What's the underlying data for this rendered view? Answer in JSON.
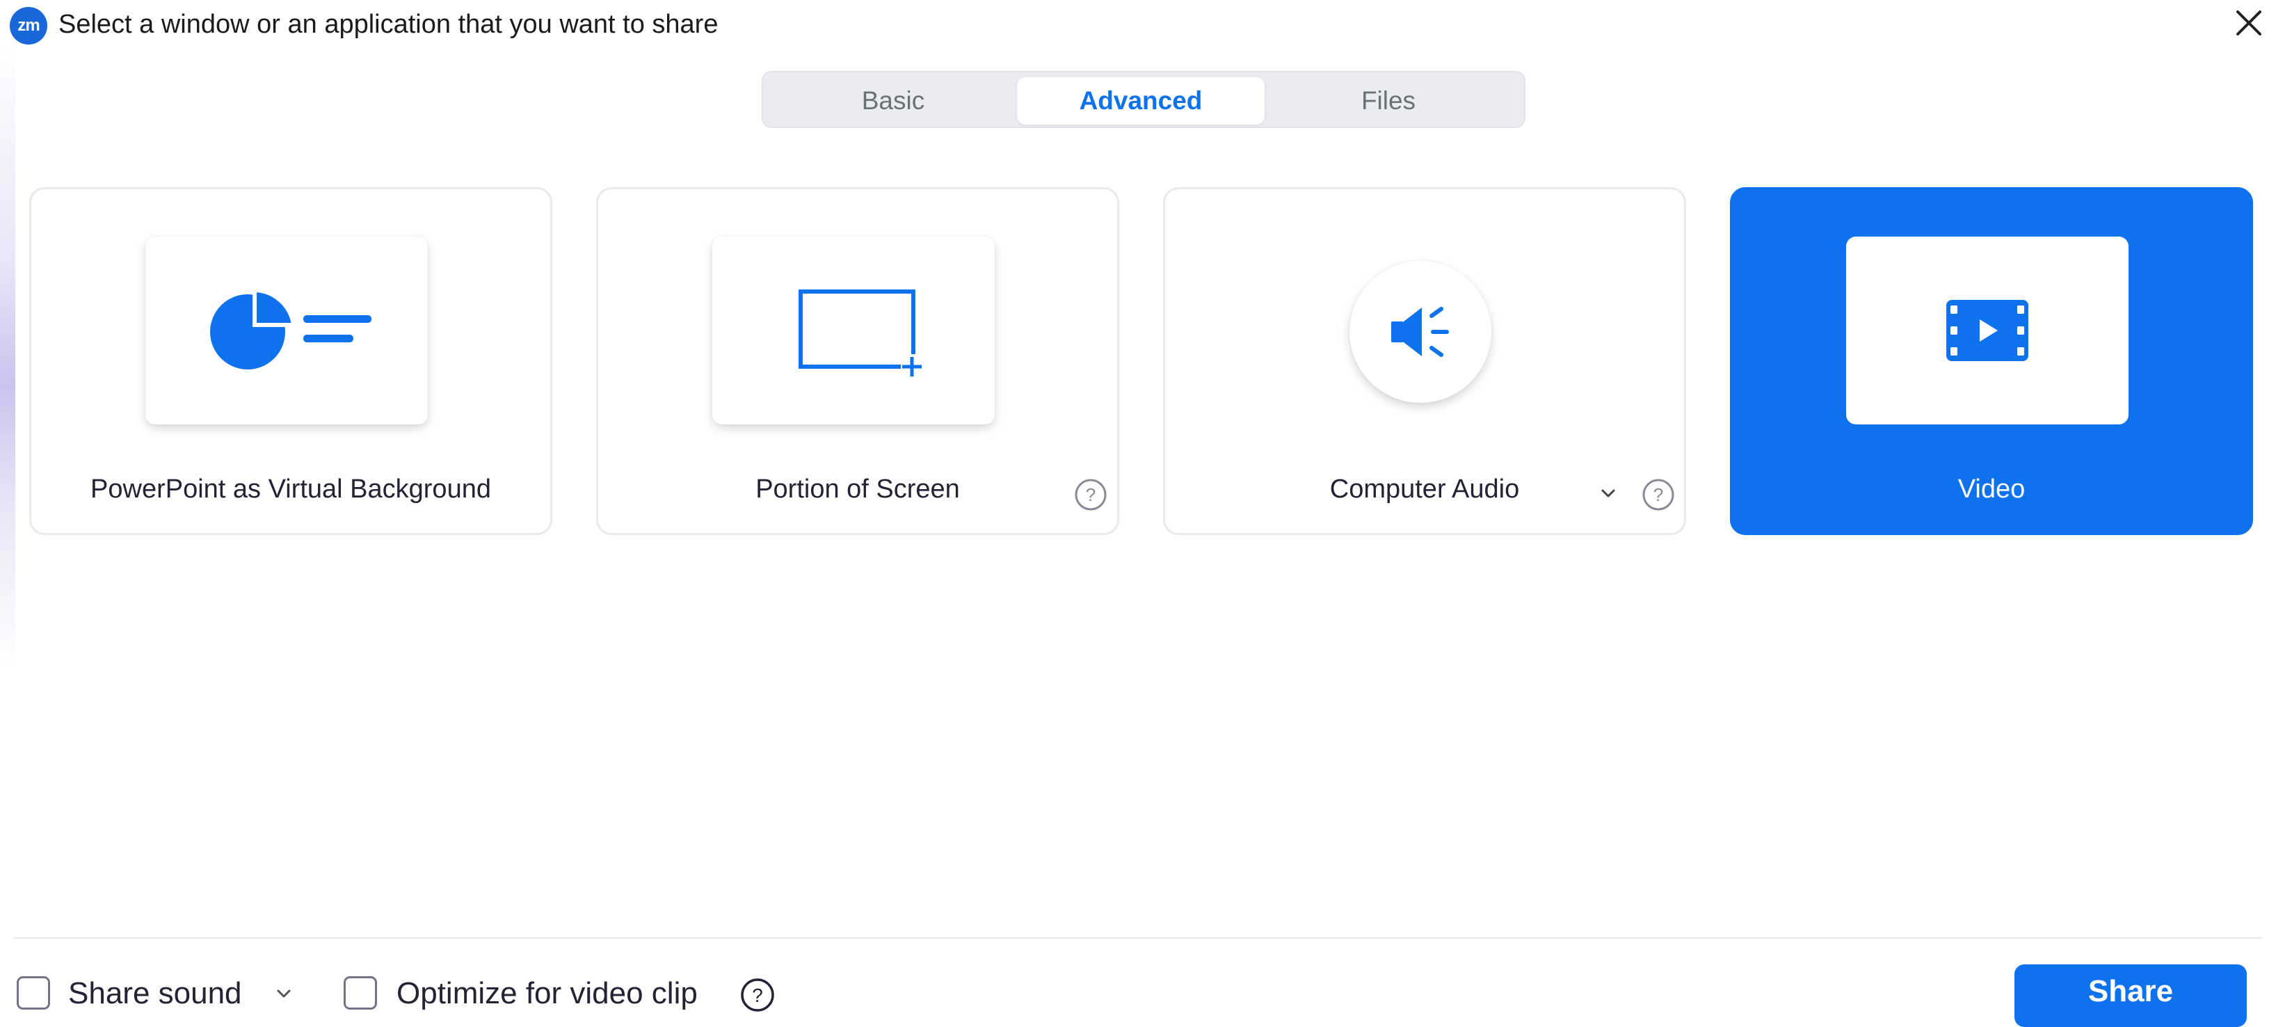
{
  "window": {
    "title": "Select a window or an application that you want to share",
    "logo_text": "zm",
    "close_icon": "close-icon"
  },
  "tabs": [
    {
      "label": "Basic",
      "selected": false
    },
    {
      "label": "Advanced",
      "selected": true
    },
    {
      "label": "Files",
      "selected": false
    }
  ],
  "options": [
    {
      "label": "PowerPoint as Virtual Background",
      "icon": "pie-chart-slides-icon",
      "selected": false
    },
    {
      "label": "Portion of Screen",
      "icon": "screen-portion-icon",
      "selected": false,
      "has_help": true
    },
    {
      "label": "Computer Audio",
      "icon": "speaker-icon",
      "selected": false,
      "has_dropdown": true,
      "has_help": true
    },
    {
      "label": "Video",
      "icon": "video-film-icon",
      "selected": true
    }
  ],
  "footer": {
    "share_sound_label": "Share sound",
    "share_sound_checked": false,
    "optimize_label": "Optimize for video clip",
    "optimize_checked": false,
    "share_button": "Share"
  },
  "colors": {
    "accent": "#0e72ed",
    "tab_bg": "#ebecef",
    "text": "#232333"
  }
}
